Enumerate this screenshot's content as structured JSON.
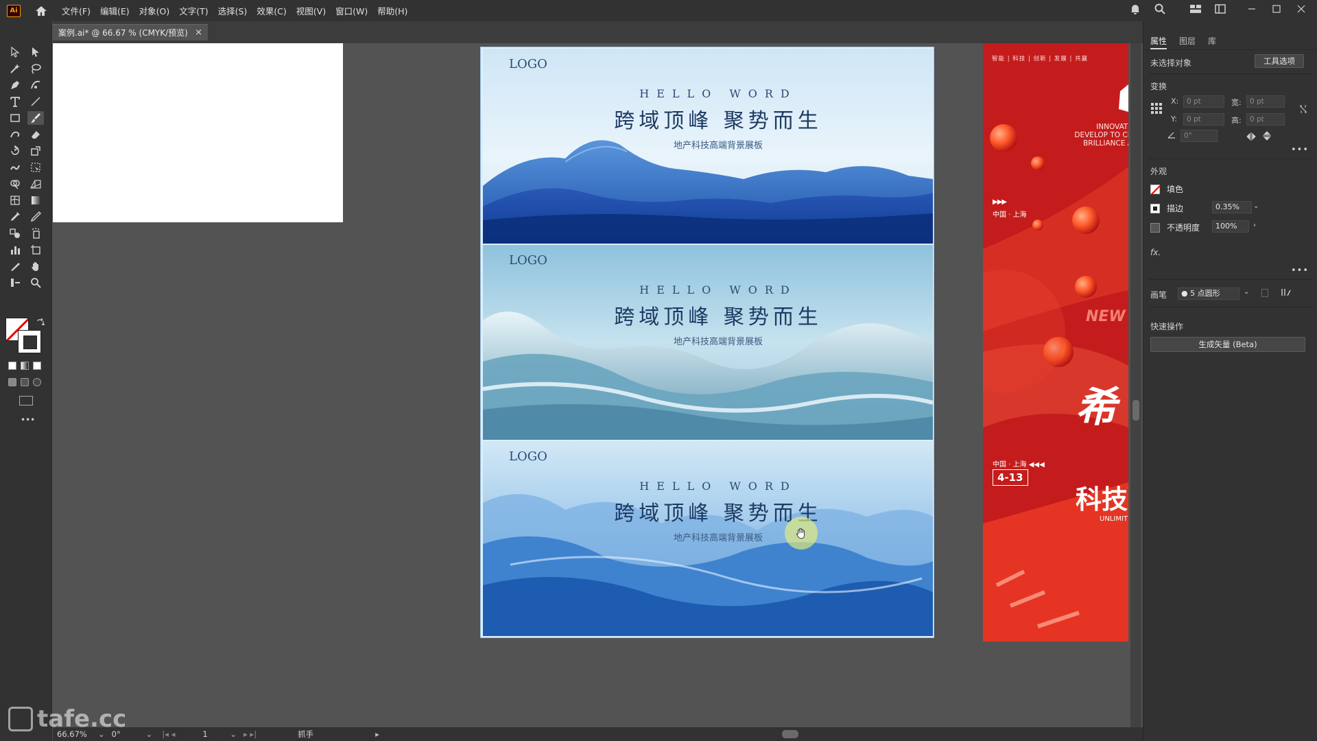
{
  "app": {
    "logo_text": "Ai",
    "menu": [
      "文件(F)",
      "编辑(E)",
      "对象(O)",
      "文字(T)",
      "选择(S)",
      "效果(C)",
      "视图(V)",
      "窗口(W)",
      "帮助(H)"
    ]
  },
  "document": {
    "tab_title": "案例.ai* @ 66.67 % (CMYK/预览)",
    "close_symbol": "×"
  },
  "poster": {
    "panels": [
      {
        "logo": "LOGO",
        "hello": "HELLO WORD",
        "headline": "跨域顶峰  聚势而生",
        "subline": "地产科技高端背景展板"
      },
      {
        "logo": "LOGO",
        "hello": "HELLO WORD",
        "headline": "跨域顶峰  聚势而生",
        "subline": "地产科技高端背景展板"
      },
      {
        "logo": "LOGO",
        "hello": "HELLO WORD",
        "headline": "跨域顶峰  聚势而生",
        "subline": "地产科技高端背景展板"
      }
    ],
    "colors": {
      "deep_blue": "#1e5fb0",
      "light_blue": "#bfe0f5",
      "teal": "#7ab6cf"
    }
  },
  "red_poster": {
    "topline": "智能 | 科技 | 创新 | 发展 | 共赢",
    "eng_lines": [
      "INNOVATE",
      "DEVELOP TO CR",
      "BRILLIANCE A"
    ],
    "arrows": "▶▶▶",
    "loc1": "中国 · 上海",
    "loc2": "中国 · 上海 ◀◀◀",
    "date": "4-13",
    "new_text": "NEW",
    "big_text_1": "希",
    "big_text_2": "科技",
    "unlimited": "UNLIMIT",
    "color": "#c81f1f"
  },
  "status": {
    "zoom": "66.67%",
    "rotation": "0°",
    "page": "1",
    "mode": "抓手"
  },
  "watermark": "tafe.cc",
  "properties": {
    "tabs": [
      "属性",
      "图层",
      "库"
    ],
    "no_selection": "未选择对象",
    "tool_options": "工具选项",
    "transform_title": "变换",
    "x_label": "X:",
    "y_label": "Y:",
    "w_label": "宽:",
    "h_label": "高:",
    "x_value": "0 pt",
    "y_value": "0 pt",
    "w_value": "0 pt",
    "h_value": "0 pt",
    "angle_value": "0°",
    "appearance_title": "外观",
    "fill_label": "填色",
    "stroke_label": "描边",
    "stroke_value": "0.35%",
    "opacity_label": "不透明度",
    "opacity_value": "100%",
    "fx": "fx.",
    "brush_label": "画笔",
    "brush_value": "5 点圆形",
    "quick_actions_title": "快速操作",
    "vectorize_button": "生成矢量 (Beta)",
    "more": "•••"
  }
}
